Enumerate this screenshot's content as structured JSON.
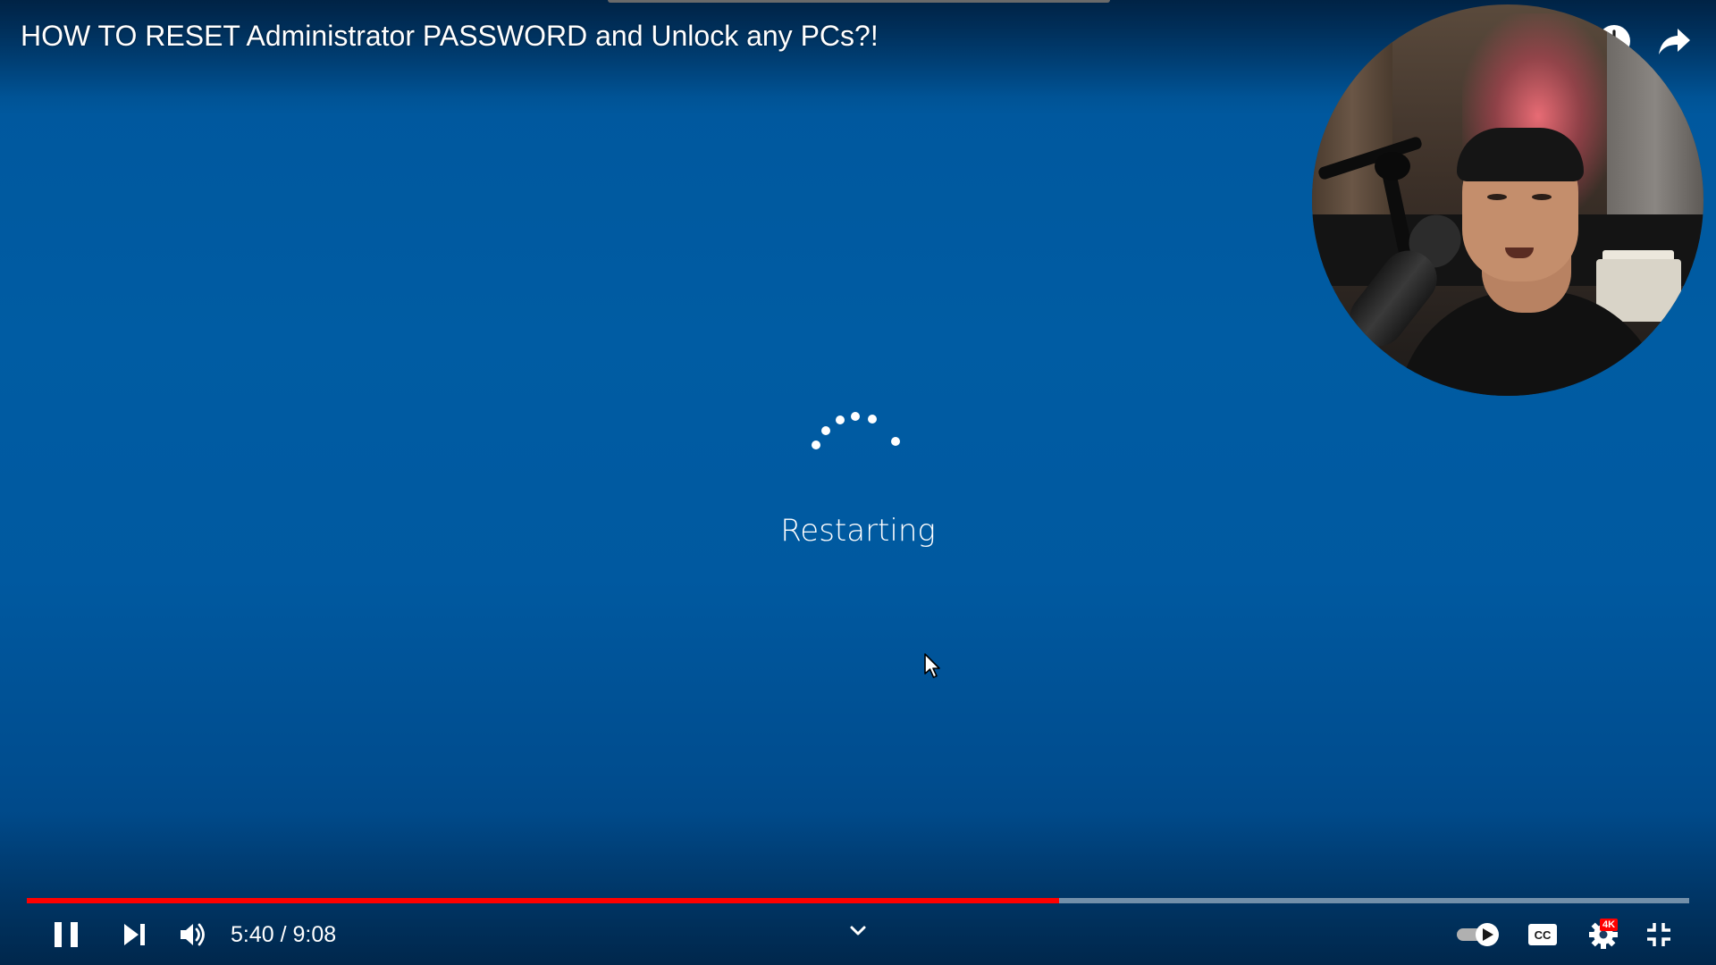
{
  "video": {
    "title": "HOW TO RESET Administrator PASSWORD and Unlock any PCs?!",
    "status_text": "Restarting",
    "background_color": "#005aa0"
  },
  "top_actions": {
    "watch_later_icon": "clock-icon",
    "share_icon": "share-arrow-icon"
  },
  "player_controls": {
    "time_display": "5:40 / 9:08",
    "current_time": "5:40",
    "duration": "9:08",
    "progress_fraction": 0.621,
    "progress_color": "#ff0000",
    "quality_badge": "4K",
    "icons": {
      "play_pause": "pause-icon",
      "next": "skip-next-icon",
      "volume": "volume-icon",
      "expand": "chevron-down-icon",
      "autoplay": "autoplay-toggle-icon",
      "captions": "cc-icon",
      "settings": "gear-icon",
      "fullscreen": "exit-fullscreen-icon"
    }
  }
}
